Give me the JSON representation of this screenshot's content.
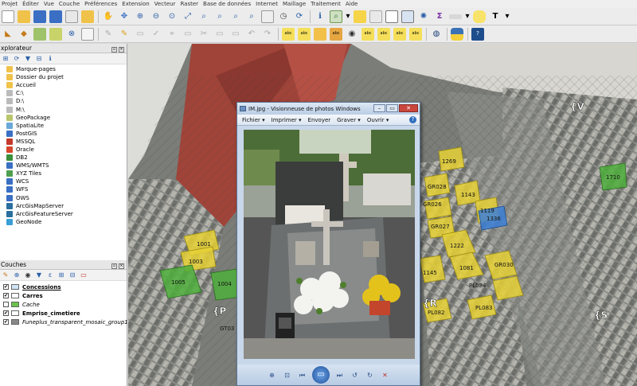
{
  "menubar": [
    "Projet",
    "Éditer",
    "Vue",
    "Couche",
    "Préférences",
    "Extension",
    "Vecteur",
    "Raster",
    "Base de données",
    "Internet",
    "Maillage",
    "Traitement",
    "Aide"
  ],
  "browser": {
    "title": "xplorateur",
    "items": [
      "Marque-pages",
      "Dossier du projet",
      "Accueil",
      "C:\\",
      "D:\\",
      "M:\\",
      "GeoPackage",
      "SpatiaLite",
      "PostGIS",
      "MSSQL",
      "Oracle",
      "DB2",
      "WMS/WMTS",
      "XYZ Tiles",
      "WCS",
      "WFS",
      "OWS",
      "ArcGisMapServer",
      "ArcGisFeatureServer",
      "GeoNode"
    ]
  },
  "layers": {
    "title": "Couches",
    "items": [
      {
        "name": "Concessions",
        "checked": true,
        "style": "bold-underline",
        "color": "#cfe3f7"
      },
      {
        "name": "Carres",
        "checked": true,
        "style": "bold",
        "color": "#ffffff"
      },
      {
        "name": "Cache",
        "checked": false,
        "style": "italic",
        "color": "#6cc24a"
      },
      {
        "name": "Emprise_cimetiere",
        "checked": true,
        "style": "bold",
        "color": "#ffffff"
      },
      {
        "name": "Funeplus_transparent_mosaic_group1",
        "checked": true,
        "style": "italic",
        "color": "#888888"
      }
    ]
  },
  "viewer": {
    "title": "IM.jpg - Visionneuse de photos Windows",
    "menu": [
      "Fichier",
      "Imprimer",
      "Envoyer",
      "Graver",
      "Ouvrir"
    ],
    "help": "?"
  },
  "map": {
    "yellow_labels": [
      "1269",
      "GR028",
      "1143",
      "1119",
      "GR026",
      "GR027",
      "1222",
      "1081",
      "GR030",
      "1145",
      "PL084",
      "PL083",
      "PL082",
      "1001",
      "1003"
    ],
    "green_labels": [
      "1005",
      "1004",
      "1710"
    ],
    "blue_labels": [
      "1336"
    ],
    "sector_labels": [
      "{V",
      "{R",
      "{S",
      "{P"
    ],
    "partial_label": "GT03"
  }
}
